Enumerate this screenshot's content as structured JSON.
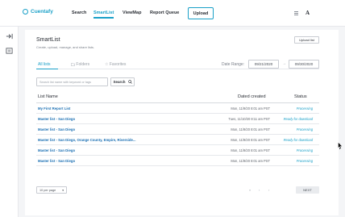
{
  "app": {
    "name": "Cuentafy"
  },
  "nav": {
    "items": [
      {
        "label": "Search"
      },
      {
        "label": "SmartList"
      },
      {
        "label": "ViewMap"
      },
      {
        "label": "Report Queue"
      }
    ],
    "active": "SmartList",
    "upload_label": "Upload",
    "avatar_initial": "A"
  },
  "rail": {
    "icons": [
      "collapse-sidebar-icon",
      "document-list-icon"
    ]
  },
  "page": {
    "title": "SmartList",
    "subtitle": "Create, upload, manage, and share lists.",
    "upload_list_label": "Upload list"
  },
  "tabs": [
    {
      "label": "All lists",
      "active": true
    },
    {
      "label": "Folders",
      "icon": "folder-icon"
    },
    {
      "label": "Favorites",
      "icon": "star-icon"
    }
  ],
  "date_range": {
    "label": "Date Range:",
    "from": "09/21/2020",
    "to": "09/30/2020"
  },
  "search": {
    "placeholder": "Search list name with keyword or tags",
    "button_label": "Search"
  },
  "table": {
    "columns": [
      "List Name",
      "Dated created",
      "Status"
    ],
    "rows": [
      {
        "name": "My First Report List",
        "date": "Mon, 11/9/20 8:01 am PST",
        "status": "Processing"
      },
      {
        "name": "Master list - San Diego",
        "date": "Tues, 11/10/20 8:11 am PST",
        "status": "Ready for download"
      },
      {
        "name": "Master list - San Diego",
        "date": "Mon, 11/9/20 8:01 am PST",
        "status": "Processing"
      },
      {
        "name": "Master list - San Diego, Orange County, Empire, Riverside...",
        "date": "Mon, 11/9/20 8:01 am PST",
        "status": "Ready for download"
      },
      {
        "name": "Master list - San Diego",
        "date": "Mon, 11/9/20 8:01 am PST",
        "status": "Processing"
      },
      {
        "name": "Master list - San Diego",
        "date": "Mon, 11/9/20 8:01 am PST",
        "status": "Processing"
      }
    ]
  },
  "pagination": {
    "per_page": "10 per page",
    "first": "«",
    "prev": "‹",
    "next_arrow": "›",
    "next_label": "NEXT"
  },
  "colors": {
    "accent": "#1aa0c8",
    "link": "#1a6fb3"
  }
}
